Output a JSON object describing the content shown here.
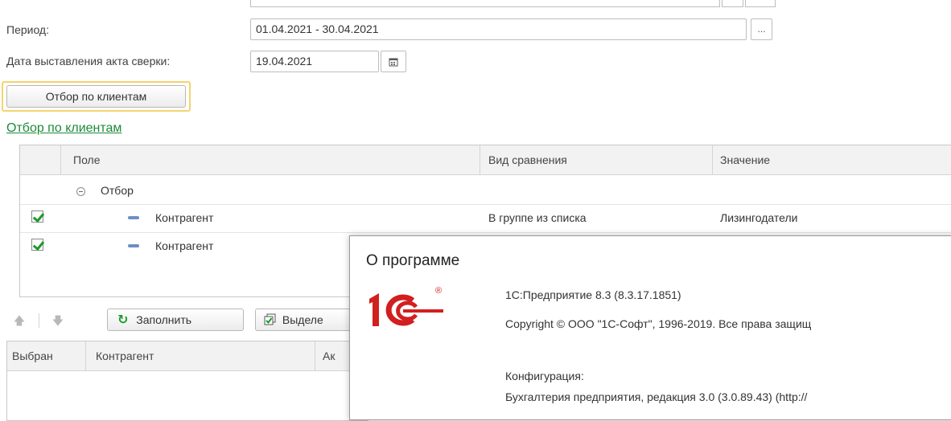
{
  "form": {
    "period_label": "Период:",
    "period_value": "01.04.2021 - 30.04.2021",
    "period_button": "...",
    "date_label": "Дата выставления акта сверки:",
    "date_value": "19.04.2021",
    "filter_button": "Отбор по клиентам",
    "filter_link": "Отбор по клиентам"
  },
  "filter_table": {
    "columns": [
      "Поле",
      "Вид сравнения",
      "Значение"
    ],
    "group_label": "Отбор",
    "rows": [
      {
        "checked": true,
        "field": "Контрагент",
        "comparison": "В группе из списка",
        "value": "Лизингодатели"
      },
      {
        "checked": true,
        "field": "Контрагент",
        "comparison": "",
        "value": ""
      }
    ]
  },
  "toolbar": {
    "up_arrow": "🡅",
    "down_arrow": "🡇",
    "fill_icon": "↻",
    "fill_label": "Заполнить",
    "select_label": "Выделе"
  },
  "clients_table": {
    "columns": [
      "Выбран",
      "Контрагент",
      "Ак"
    ]
  },
  "about": {
    "title": "О программе",
    "logo_text": "1С",
    "logo_mark": "®",
    "platform": "1С:Предприятие 8.3 (8.3.17.1851)",
    "copyright": "Copyright © ООО \"1С-Софт\", 1996-2019. Все права защищ",
    "config_label": "Конфигурация:",
    "config_value": "Бухгалтерия предприятия, редакция 3.0 (3.0.89.43) (http://"
  },
  "colors": {
    "link": "#1d8a3a",
    "checkbox_mark": "#1a9a2a",
    "highlight_frame": "#f5d46b",
    "logo_red": "#d21f1f"
  }
}
